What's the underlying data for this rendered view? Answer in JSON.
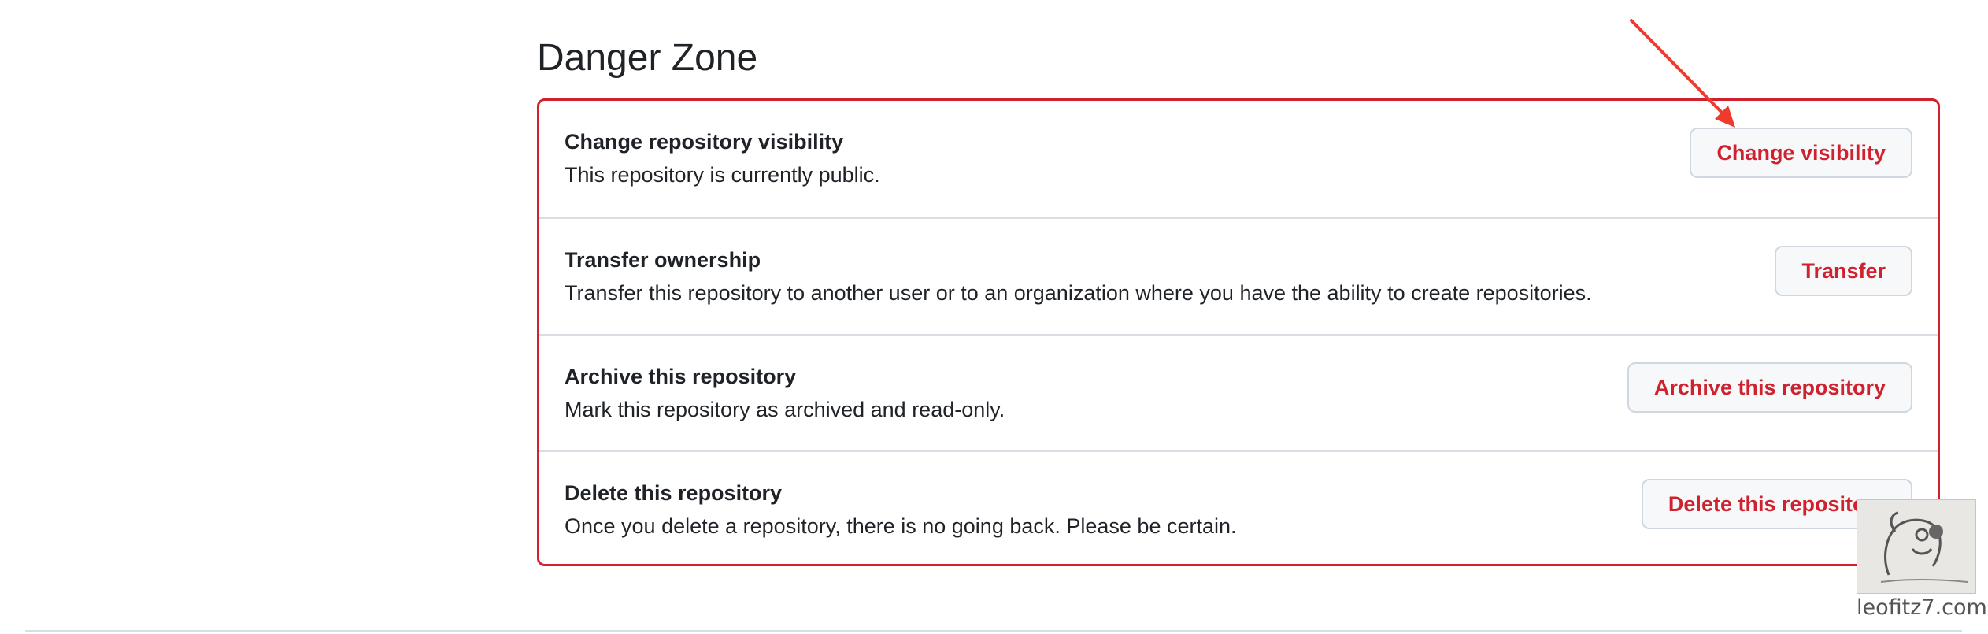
{
  "section": {
    "heading": "Danger Zone"
  },
  "rows": [
    {
      "title": "Change repository visibility",
      "description": "This repository is currently public.",
      "button": "Change visibility"
    },
    {
      "title": "Transfer ownership",
      "description": "Transfer this repository to another user or to an organization where you have the ability to create repositories.",
      "button": "Transfer"
    },
    {
      "title": "Archive this repository",
      "description": "Mark this repository as archived and read-only.",
      "button": "Archive this repository"
    },
    {
      "title": "Delete this repository",
      "description": "Once you delete a repository, there is no going back. Please be certain.",
      "button": "Delete this repository"
    }
  ],
  "annotation": {
    "arrow_color": "#f03a2e"
  },
  "watermark": {
    "text": "leofitz7.com"
  },
  "colors": {
    "danger": "#cf222e",
    "button_bg": "#f6f8fa",
    "border_muted": "#d8dee4"
  }
}
